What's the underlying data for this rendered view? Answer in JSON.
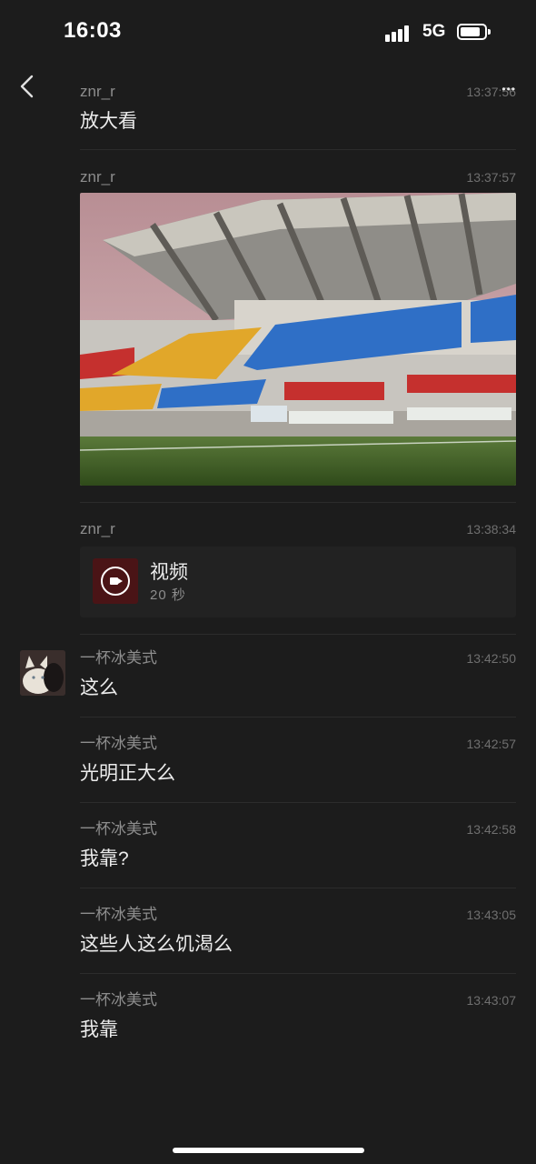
{
  "status_bar": {
    "time": "16:03",
    "network": "5G",
    "battery_level": 0.85
  },
  "header": {
    "more_label": "•••"
  },
  "messages": [
    {
      "sender": "znr_r",
      "time": "13:37:56",
      "text": "放大看"
    },
    {
      "sender": "znr_r",
      "time": "13:37:57",
      "type": "image"
    },
    {
      "sender": "znr_r",
      "time": "13:38:34",
      "type": "video",
      "video_title": "视频",
      "video_duration": "20 秒"
    },
    {
      "sender": "一杯冰美式",
      "time": "13:42:50",
      "text": "这么"
    },
    {
      "sender": "一杯冰美式",
      "time": "13:42:57",
      "text": "光明正大么"
    },
    {
      "sender": "一杯冰美式",
      "time": "13:42:58",
      "text": "我靠?"
    },
    {
      "sender": "一杯冰美式",
      "time": "13:43:05",
      "text": "这些人这么饥渴么"
    },
    {
      "sender": "一杯冰美式",
      "time": "13:43:07",
      "text": "我靠"
    }
  ],
  "colors": {
    "background": "#1c1c1c",
    "text": "#ececec",
    "meta": "#8d8d8d"
  }
}
